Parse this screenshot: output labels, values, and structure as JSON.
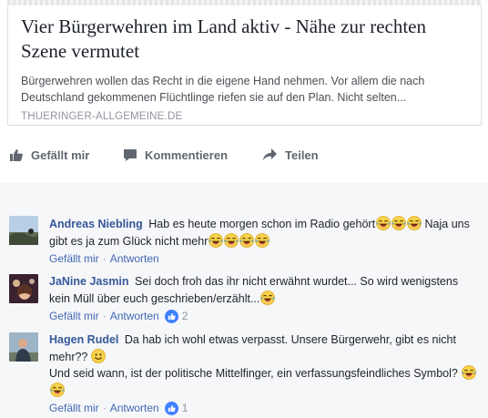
{
  "link_preview": {
    "title": "Vier Bürgerwehren im Land aktiv - Nähe zur rechten Szene vermutet",
    "description": "Bürgerwehren wollen das Recht in die eigene Hand nehmen. Vor allem die nach Deutschland gekommenen Flüchtlinge riefen sie auf den Plan. Nicht selten...",
    "domain": "THUERINGER-ALLGEMEINE.DE"
  },
  "actions": {
    "like_label": "Gefällt mir",
    "comment_label": "Kommentieren",
    "share_label": "Teilen"
  },
  "colors": {
    "name_blue": "#365899",
    "link_blue": "#4267b2",
    "meta_gray": "#90949c",
    "like_badge": "#4080ff"
  },
  "comments": [
    {
      "author": "Andreas Niebling",
      "text_1": "Hab es heute morgen schon im Radio gehört",
      "text_2": "Naja uns gibt es ja zum Glück nicht mehr",
      "like_label": "Gefällt mir",
      "reply_label": "Antworten"
    },
    {
      "author": "JaNine Jasmin",
      "text_1": "Sei doch froh das ihr nicht erwähnt wurdet... So wird wenigstens kein Müll über euch geschrieben/erzählt...",
      "like_label": "Gefällt mir",
      "reply_label": "Antworten",
      "reaction_count": "2"
    },
    {
      "author": "Hagen Rudel",
      "text_1": "Da hab ich wohl etwas verpasst. Unsere Bürgerwehr, gibt es nicht mehr??",
      "text_2": "Und seid wann, ist der politische Mittelfinger, ein verfassungsfeindliches Symbol?",
      "like_label": "Gefällt mir",
      "reply_label": "Antworten",
      "reaction_count": "1"
    }
  ]
}
